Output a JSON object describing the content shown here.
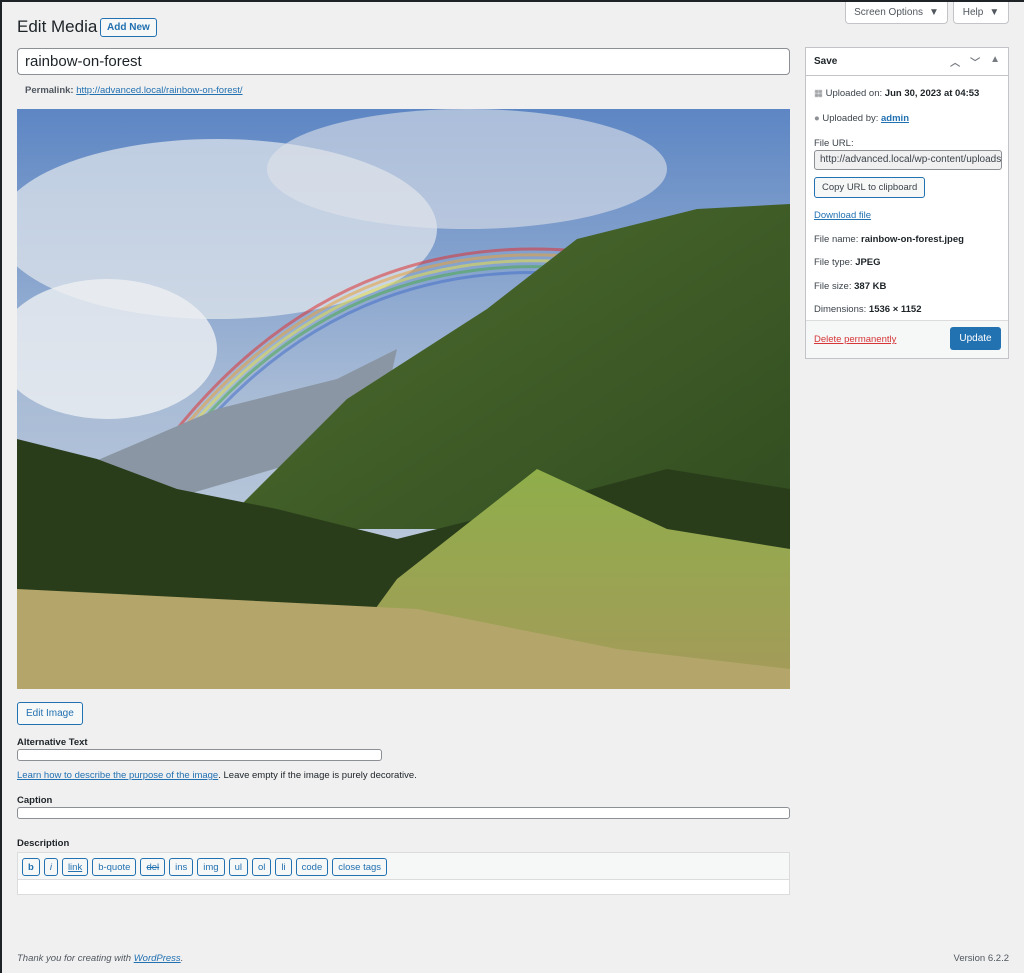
{
  "header": {
    "screen_options": "Screen Options",
    "help": "Help",
    "title": "Edit Media",
    "add_new": "Add New"
  },
  "post": {
    "title": "rainbow-on-forest",
    "permalink_label": "Permalink:",
    "permalink": "http://advanced.local/rainbow-on-forest/"
  },
  "image": {
    "alt": "rainbow-on-forest",
    "edit_image": "Edit Image"
  },
  "fields": {
    "alt_label": "Alternative Text",
    "alt_value": "",
    "alt_help_link": "Learn how to describe the purpose of the image",
    "alt_help_text": ". Leave empty if the image is purely decorative.",
    "caption_label": "Caption",
    "caption_value": "",
    "description_label": "Description",
    "description_value": "",
    "quicktags": [
      "b",
      "i",
      "link",
      "b-quote",
      "del",
      "ins",
      "img",
      "ul",
      "ol",
      "li",
      "code",
      "close tags"
    ]
  },
  "save_box": {
    "title": "Save",
    "uploaded_on_label": "Uploaded on:",
    "uploaded_on": "Jun 30, 2023 at 04:53",
    "uploaded_by_label": "Uploaded by:",
    "uploaded_by": "admin",
    "file_url_label": "File URL:",
    "file_url": "http://advanced.local/wp-content/uploads/",
    "copy_url": "Copy URL to clipboard",
    "download": "Download file",
    "file_name_label": "File name:",
    "file_name": "rainbow-on-forest.jpeg",
    "file_type_label": "File type:",
    "file_type": "JPEG",
    "file_size_label": "File size:",
    "file_size": "387 KB",
    "dimensions_label": "Dimensions:",
    "dimensions": "1536 × 1152",
    "delete": "Delete permanently",
    "update": "Update"
  },
  "footer": {
    "thanks": "Thank you for creating with ",
    "wp_link": "WordPress",
    "thanks_end": ".",
    "version": "Version 6.2.2"
  },
  "colors": {
    "accent": "#2271b1",
    "delete": "#d63638",
    "background": "#f0f0f1"
  }
}
